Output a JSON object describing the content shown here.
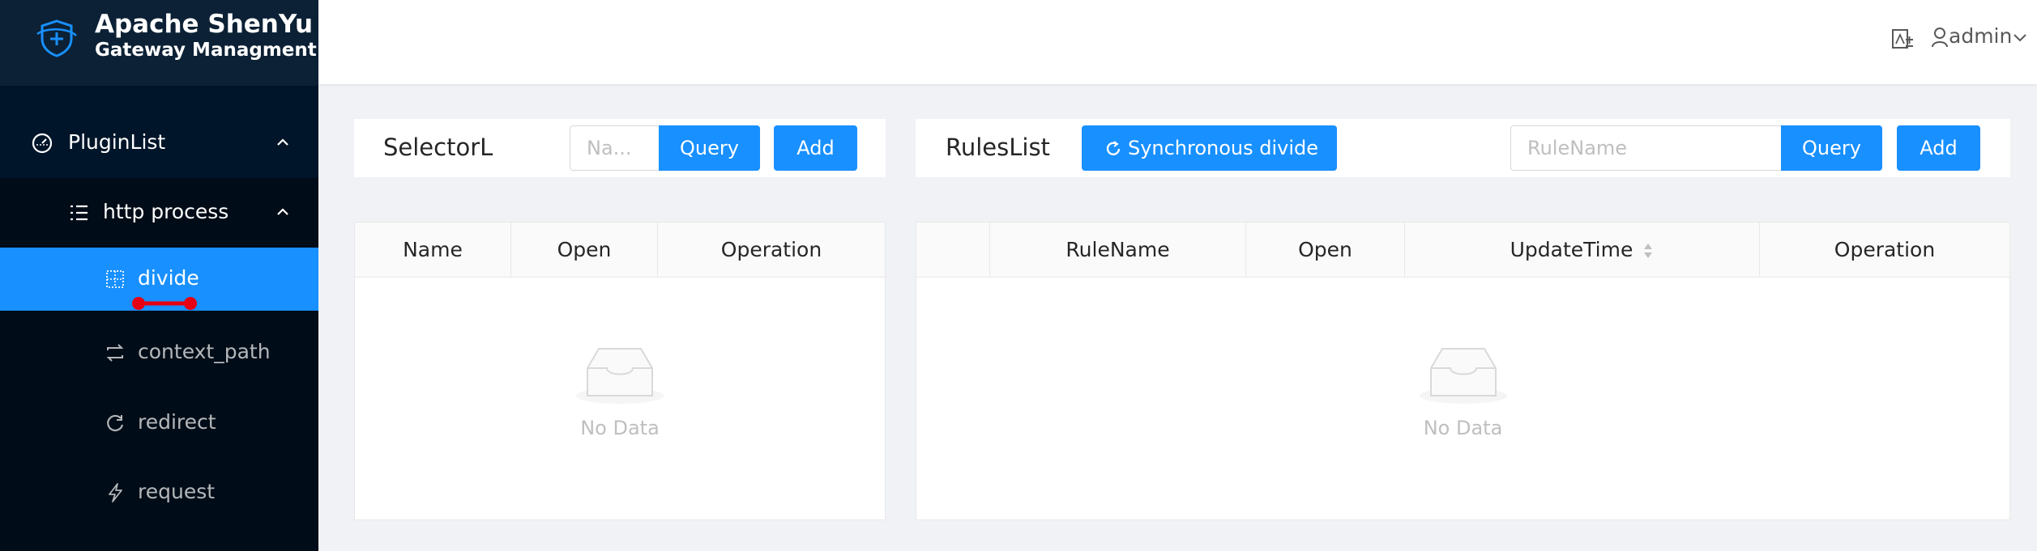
{
  "brand": {
    "title": "Apache ShenYu",
    "subtitle": "Gateway Managment"
  },
  "sidebar": {
    "plugin_list": {
      "label": "PluginList",
      "icon": "dashboard-icon",
      "expanded": true
    },
    "group": {
      "label": "http process",
      "icon": "list-icon",
      "expanded": true
    },
    "items": [
      {
        "label": "divide",
        "icon": "divide-icon",
        "active": true
      },
      {
        "label": "context_path",
        "icon": "swap-icon",
        "active": false
      },
      {
        "label": "redirect",
        "icon": "redo-icon",
        "active": false
      },
      {
        "label": "request",
        "icon": "thunderbolt-icon",
        "active": false
      }
    ]
  },
  "header": {
    "language_icon": "translate-icon",
    "user": "admin"
  },
  "selector": {
    "title": "SelectorL",
    "search_placeholder": "Na...",
    "query_label": "Query",
    "add_label": "Add",
    "columns": [
      "Name",
      "Open",
      "Operation"
    ],
    "empty_text": "No Data"
  },
  "rules": {
    "title": "RulesList",
    "sync_label": "Synchronous divide",
    "search_placeholder": "RuleName",
    "query_label": "Query",
    "add_label": "Add",
    "columns": [
      "",
      "RuleName",
      "Open",
      "UpdateTime",
      "Operation"
    ],
    "empty_text": "No Data"
  },
  "colors": {
    "primary": "#1890ff",
    "sidebar_bg": "#001529",
    "submenu_bg": "#000c17",
    "page_bg": "#f0f2f5"
  }
}
